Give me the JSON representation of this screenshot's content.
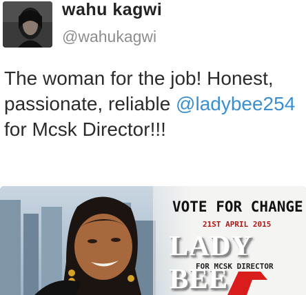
{
  "tweet": {
    "display_name": "wahu kagwi",
    "handle": "@wahukagwi",
    "text_before": "The woman for the job! Honest, passionate, reliable ",
    "mention": "@ladybee254",
    "text_after": "  for Mcsk Director!!!"
  },
  "media": {
    "headline": "VOTE FOR CHANGE",
    "date": "21ST APRIL 2015",
    "candidate": "LADY BEE",
    "role": "FOR MCSK DIRECTOR"
  },
  "colors": {
    "mention": "#3b8fd0",
    "date_red": "#b01818",
    "logo_red": "#d91c1c"
  }
}
